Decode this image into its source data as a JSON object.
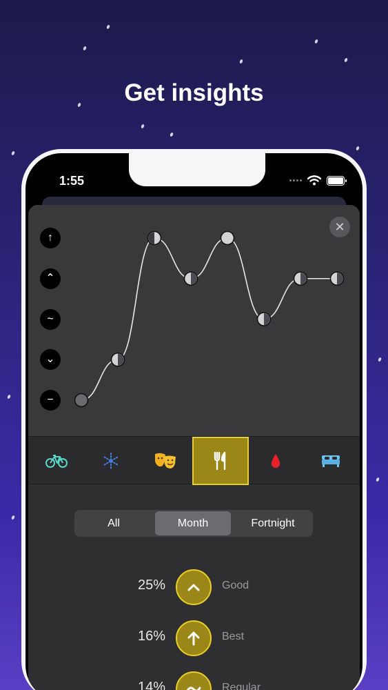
{
  "headline": "Get insights",
  "status_bar": {
    "time": "1:55"
  },
  "chart_data": {
    "type": "line",
    "x": [
      1,
      2,
      3,
      4,
      5,
      6,
      7,
      8
    ],
    "values": [
      1,
      2,
      5,
      4,
      5,
      3,
      4,
      4
    ],
    "ylim": [
      1,
      5
    ],
    "y_levels": [
      "↑",
      "⌃",
      "~",
      "⌄",
      "−"
    ],
    "grid": false,
    "colors": {
      "line": "#e8e8e8",
      "marker_light": "#d4d4d6",
      "marker_dark": "#3a3a3c"
    }
  },
  "sheet": {
    "close_label": "✕"
  },
  "tabs": [
    {
      "name": "bike",
      "icon": "bicycle-icon",
      "color": "#5ad8c8"
    },
    {
      "name": "snow",
      "icon": "snowflake-icon",
      "color": "#4a7fe0"
    },
    {
      "name": "theatre",
      "icon": "theatre-masks-icon",
      "color": "#f0b020"
    },
    {
      "name": "food",
      "icon": "fork-knife-icon",
      "color": "#ffffff",
      "active": true
    },
    {
      "name": "drop",
      "icon": "blood-drop-icon",
      "color": "#e8212c"
    },
    {
      "name": "bed",
      "icon": "bed-icon",
      "color": "#6cc4f0"
    }
  ],
  "range_selector": {
    "options": [
      "All",
      "Month",
      "Fortnight"
    ],
    "selected": "Month"
  },
  "mood_stats": [
    {
      "percent": "25%",
      "label": "Good",
      "icon": "chevron-up-icon"
    },
    {
      "percent": "16%",
      "label": "Best",
      "icon": "arrow-up-icon"
    },
    {
      "percent": "14%",
      "label": "Regular",
      "icon": "wave-icon"
    }
  ],
  "colors": {
    "accent_gold": "#e9cf28",
    "accent_gold_dark": "#9b8717"
  }
}
